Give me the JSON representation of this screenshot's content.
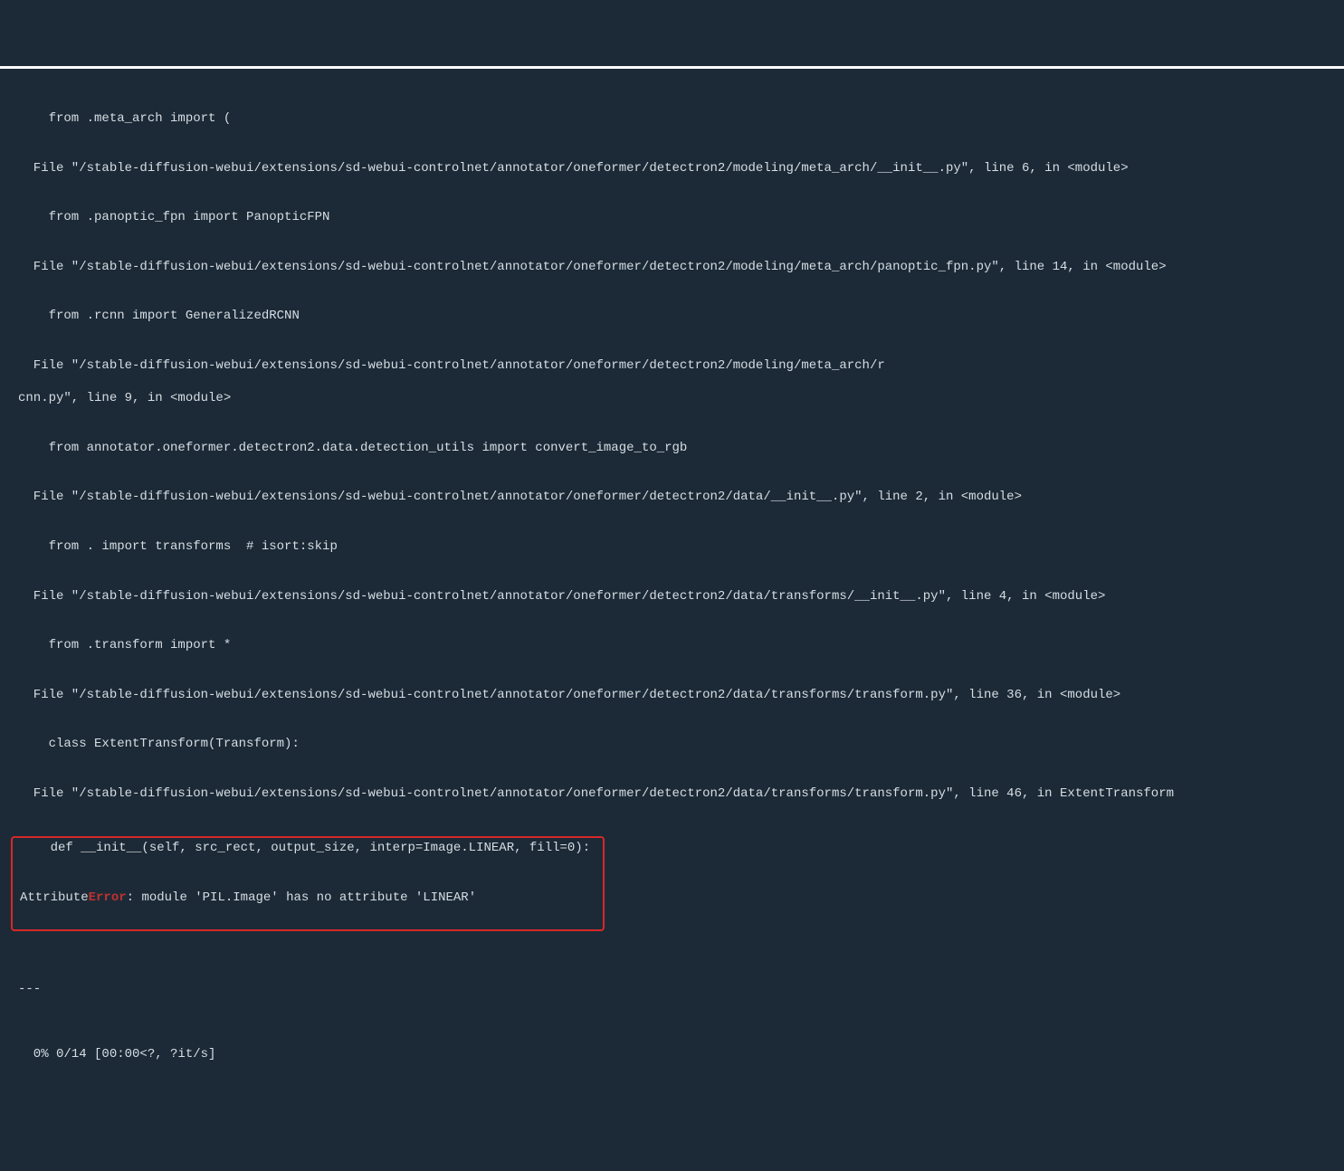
{
  "traceback": {
    "l01": "    from .meta_arch import (",
    "l02": "",
    "l03": "  File \"/stable-diffusion-webui/extensions/sd-webui-controlnet/annotator/oneformer/detectron2/modeling/meta_arch/__init__.py\", line 6, in <module>",
    "l04": "",
    "l05": "    from .panoptic_fpn import PanopticFPN",
    "l06": "",
    "l07": "  File \"/stable-diffusion-webui/extensions/sd-webui-controlnet/annotator/oneformer/detectron2/modeling/meta_arch/panoptic_fpn.py\", line 14, in <module>",
    "l08": "",
    "l09": "    from .rcnn import GeneralizedRCNN",
    "l10": "",
    "l11": "  File \"/stable-diffusion-webui/extensions/sd-webui-controlnet/annotator/oneformer/detectron2/modeling/meta_arch/r",
    "l12": "cnn.py\", line 9, in <module>",
    "l13": "",
    "l14": "    from annotator.oneformer.detectron2.data.detection_utils import convert_image_to_rgb",
    "l15": "",
    "l16": "  File \"/stable-diffusion-webui/extensions/sd-webui-controlnet/annotator/oneformer/detectron2/data/__init__.py\", line 2, in <module>",
    "l17": "",
    "l18": "    from . import transforms  # isort:skip",
    "l19": "",
    "l20": "  File \"/stable-diffusion-webui/extensions/sd-webui-controlnet/annotator/oneformer/detectron2/data/transforms/__init__.py\", line 4, in <module>",
    "l21": "",
    "l22": "    from .transform import *",
    "l23": "",
    "l24": "  File \"/stable-diffusion-webui/extensions/sd-webui-controlnet/annotator/oneformer/detectron2/data/transforms/transform.py\", line 36, in <module>",
    "l25": "",
    "l26": "    class ExtentTransform(Transform):",
    "l27": "",
    "l28": "  File \"/stable-diffusion-webui/extensions/sd-webui-controlnet/annotator/oneformer/detectron2/data/transforms/transform.py\", line 46, in ExtentTransform",
    "l29": "",
    "l30": "    def __init__(self, src_rect, output_size, interp=Image.LINEAR, fill=0):",
    "l31": "",
    "err_pre": "Attribute",
    "err_word": "Error",
    "err_post": ": module 'PIL.Image' has no attribute 'LINEAR'",
    "l33": "",
    "l34": "",
    "l35": "",
    "l36": "---",
    "l37": "",
    "l38": "",
    "l39": "  0% 0/14 [00:00<?, ?it/s]"
  }
}
